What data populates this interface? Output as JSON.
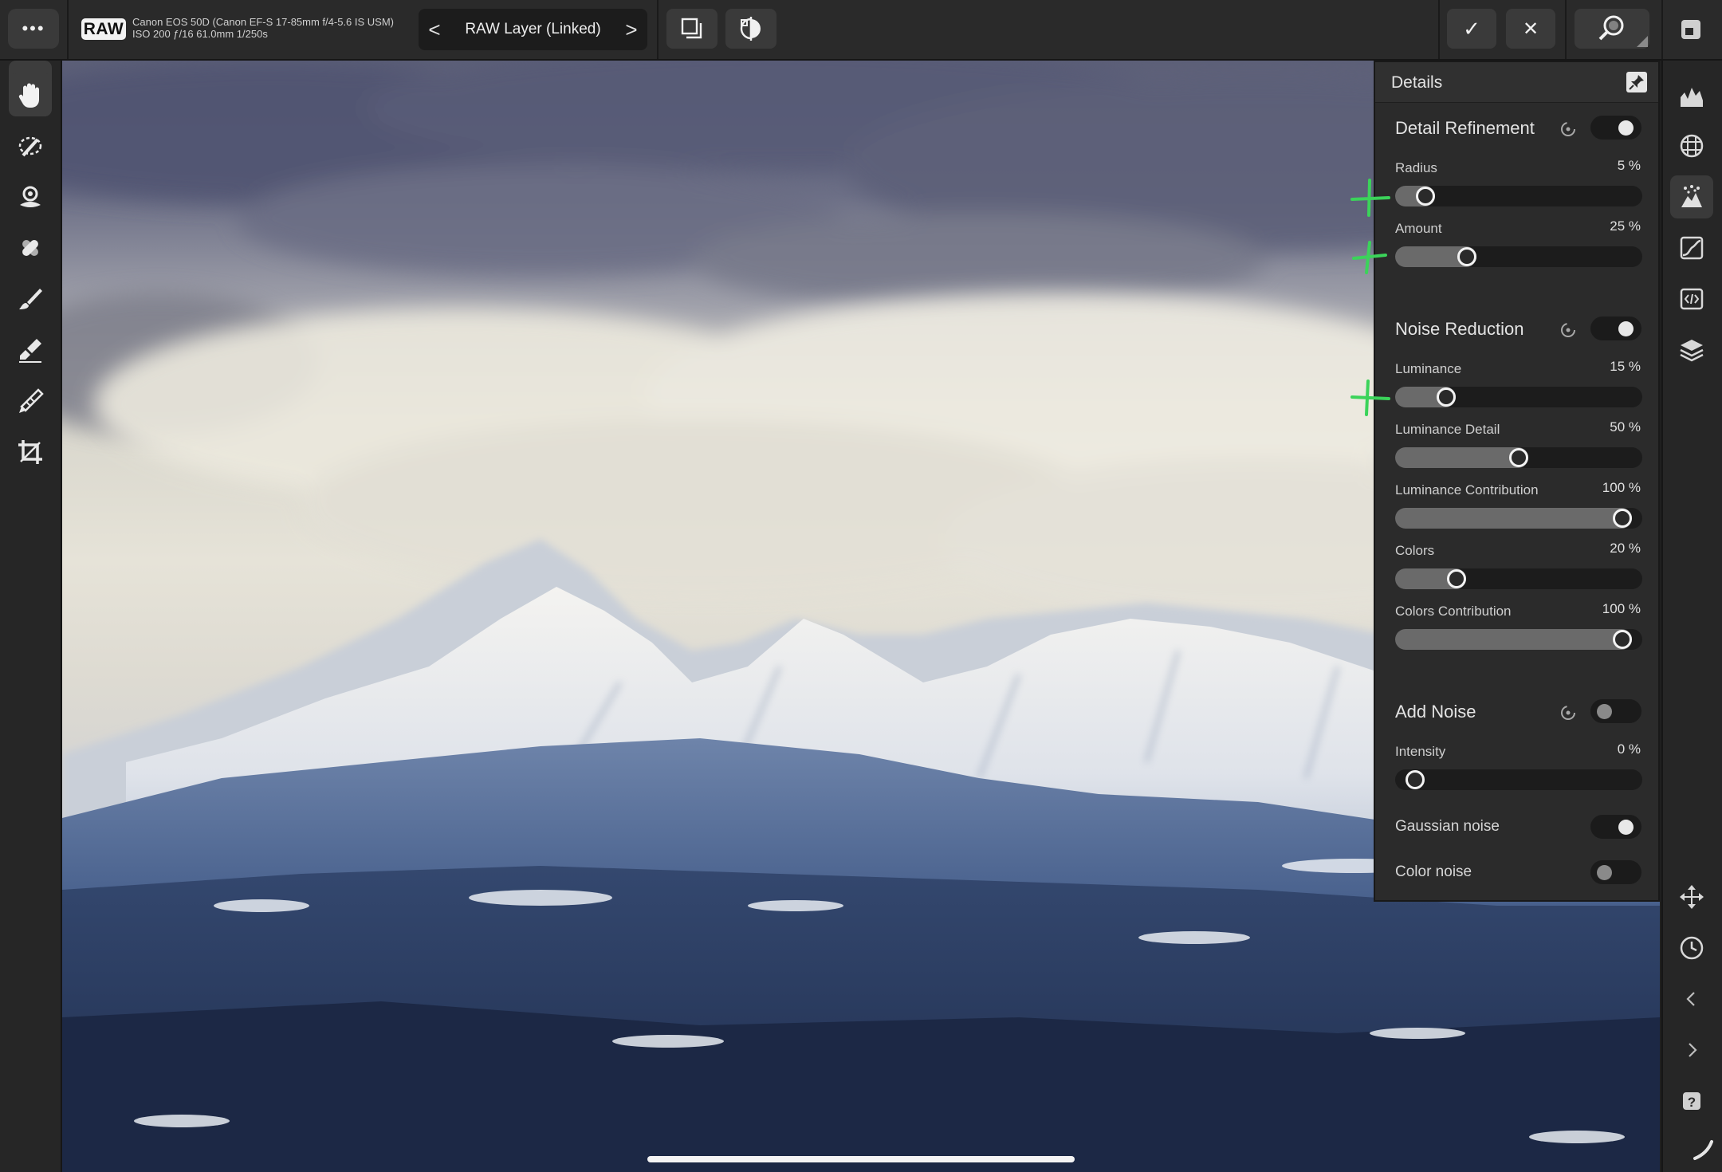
{
  "topbar": {
    "raw_badge": "RAW",
    "camera_line1": "Canon EOS 50D (Canon EF-S 17-85mm f/4-5.6 IS USM)",
    "camera_line2": "ISO 200 ƒ/16 61.0mm 1/250s",
    "layer_label": "RAW Layer (Linked)",
    "prev_arrow": "<",
    "next_arrow": ">",
    "menu_dots": "•••",
    "apply_glyph": "✓",
    "cancel_glyph": "✕"
  },
  "panel": {
    "title": "Details",
    "sections": {
      "detail_refinement": {
        "title": "Detail Refinement",
        "enabled": true,
        "params": [
          {
            "label": "Radius",
            "value": "5 %",
            "level": 0.05
          },
          {
            "label": "Amount",
            "value": "25 %",
            "level": 0.25
          }
        ]
      },
      "noise_reduction": {
        "title": "Noise Reduction",
        "enabled": true,
        "params": [
          {
            "label": "Luminance",
            "value": "15 %",
            "level": 0.15
          },
          {
            "label": "Luminance Detail",
            "value": "50 %",
            "level": 0.5
          },
          {
            "label": "Luminance Contribution",
            "value": "100 %",
            "level": 1.0
          },
          {
            "label": "Colors",
            "value": "20 %",
            "level": 0.2
          },
          {
            "label": "Colors Contribution",
            "value": "100 %",
            "level": 1.0
          }
        ]
      },
      "add_noise": {
        "title": "Add Noise",
        "enabled": false,
        "params": [
          {
            "label": "Intensity",
            "value": "0 %",
            "level": 0.0
          }
        ],
        "toggles": [
          {
            "label": "Gaussian noise",
            "enabled": true
          },
          {
            "label": "Color noise",
            "enabled": false
          }
        ]
      }
    }
  },
  "colors": {
    "panel_bg": "#2b2b2b",
    "track_bg": "#1c1c1c",
    "track_fill": "#6a6a6a",
    "marker_green": "#3bd35a"
  },
  "left_tools": [
    "hand-icon",
    "selection-brush-icon",
    "overlay-icon",
    "healing-icon",
    "brush-icon",
    "eraser-icon",
    "gradient-brush-icon",
    "crop-icon"
  ],
  "right_rail": [
    "histogram-icon",
    "lens-icon",
    "details-icon",
    "tones-icon",
    "code-icon",
    "layers-icon",
    "transform-icon",
    "history-icon",
    "collapse-left-icon",
    "expand-right-icon",
    "help-icon",
    "pencil-icon"
  ]
}
